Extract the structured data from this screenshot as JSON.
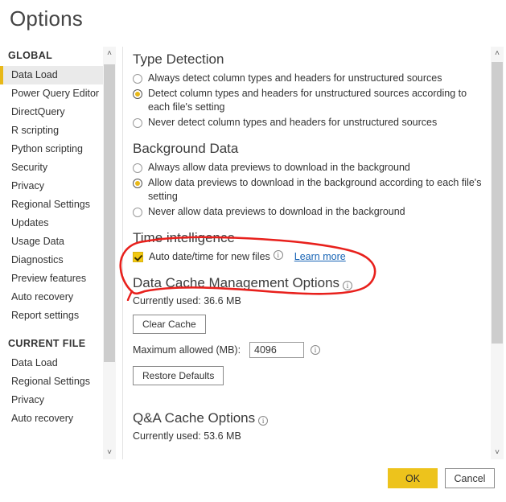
{
  "dialog": {
    "title": "Options"
  },
  "sidebar": {
    "groups": [
      {
        "header": "GLOBAL",
        "items": [
          {
            "label": "Data Load",
            "selected": true
          },
          {
            "label": "Power Query Editor",
            "selected": false
          },
          {
            "label": "DirectQuery",
            "selected": false
          },
          {
            "label": "R scripting",
            "selected": false
          },
          {
            "label": "Python scripting",
            "selected": false
          },
          {
            "label": "Security",
            "selected": false
          },
          {
            "label": "Privacy",
            "selected": false
          },
          {
            "label": "Regional Settings",
            "selected": false
          },
          {
            "label": "Updates",
            "selected": false
          },
          {
            "label": "Usage Data",
            "selected": false
          },
          {
            "label": "Diagnostics",
            "selected": false
          },
          {
            "label": "Preview features",
            "selected": false
          },
          {
            "label": "Auto recovery",
            "selected": false
          },
          {
            "label": "Report settings",
            "selected": false
          }
        ]
      },
      {
        "header": "CURRENT FILE",
        "items": [
          {
            "label": "Data Load",
            "selected": false
          },
          {
            "label": "Regional Settings",
            "selected": false
          },
          {
            "label": "Privacy",
            "selected": false
          },
          {
            "label": "Auto recovery",
            "selected": false
          }
        ]
      }
    ]
  },
  "content": {
    "type_detection": {
      "heading": "Type Detection",
      "options": [
        {
          "label": "Always detect column types and headers for unstructured sources",
          "selected": false
        },
        {
          "label": "Detect column types and headers for unstructured sources according to each file's setting",
          "selected": true
        },
        {
          "label": "Never detect column types and headers for unstructured sources",
          "selected": false
        }
      ]
    },
    "background_data": {
      "heading": "Background Data",
      "options": [
        {
          "label": "Always allow data previews to download in the background",
          "selected": false
        },
        {
          "label": "Allow data previews to download in the background according to each file's setting",
          "selected": true
        },
        {
          "label": "Never allow data previews to download in the background",
          "selected": false
        }
      ]
    },
    "time_intelligence": {
      "heading": "Time intelligence",
      "checkbox_label": "Auto date/time for new files",
      "checked": true,
      "learn_more": "Learn more"
    },
    "data_cache": {
      "heading": "Data Cache Management Options",
      "currently_used": "Currently used: 36.6 MB",
      "clear_cache_label": "Clear Cache",
      "max_allowed_label": "Maximum allowed (MB):",
      "max_allowed_value": "4096",
      "restore_defaults_label": "Restore Defaults"
    },
    "qna_cache": {
      "heading": "Q&A Cache Options",
      "currently_used": "Currently used: 53.6 MB"
    }
  },
  "footer": {
    "ok_label": "OK",
    "cancel_label": "Cancel"
  },
  "annotation": {
    "shape": "hand-drawn-red-ellipse",
    "color": "#e8201c",
    "targets": "Time intelligence section"
  },
  "icons": {
    "scroll_up": "˄",
    "scroll_down": "˅",
    "info": "i"
  },
  "colors": {
    "accent_yellow": "#f2c811",
    "ok_button": "#edc31c",
    "link_blue": "#1663b5",
    "annotation_red": "#e8201c"
  }
}
